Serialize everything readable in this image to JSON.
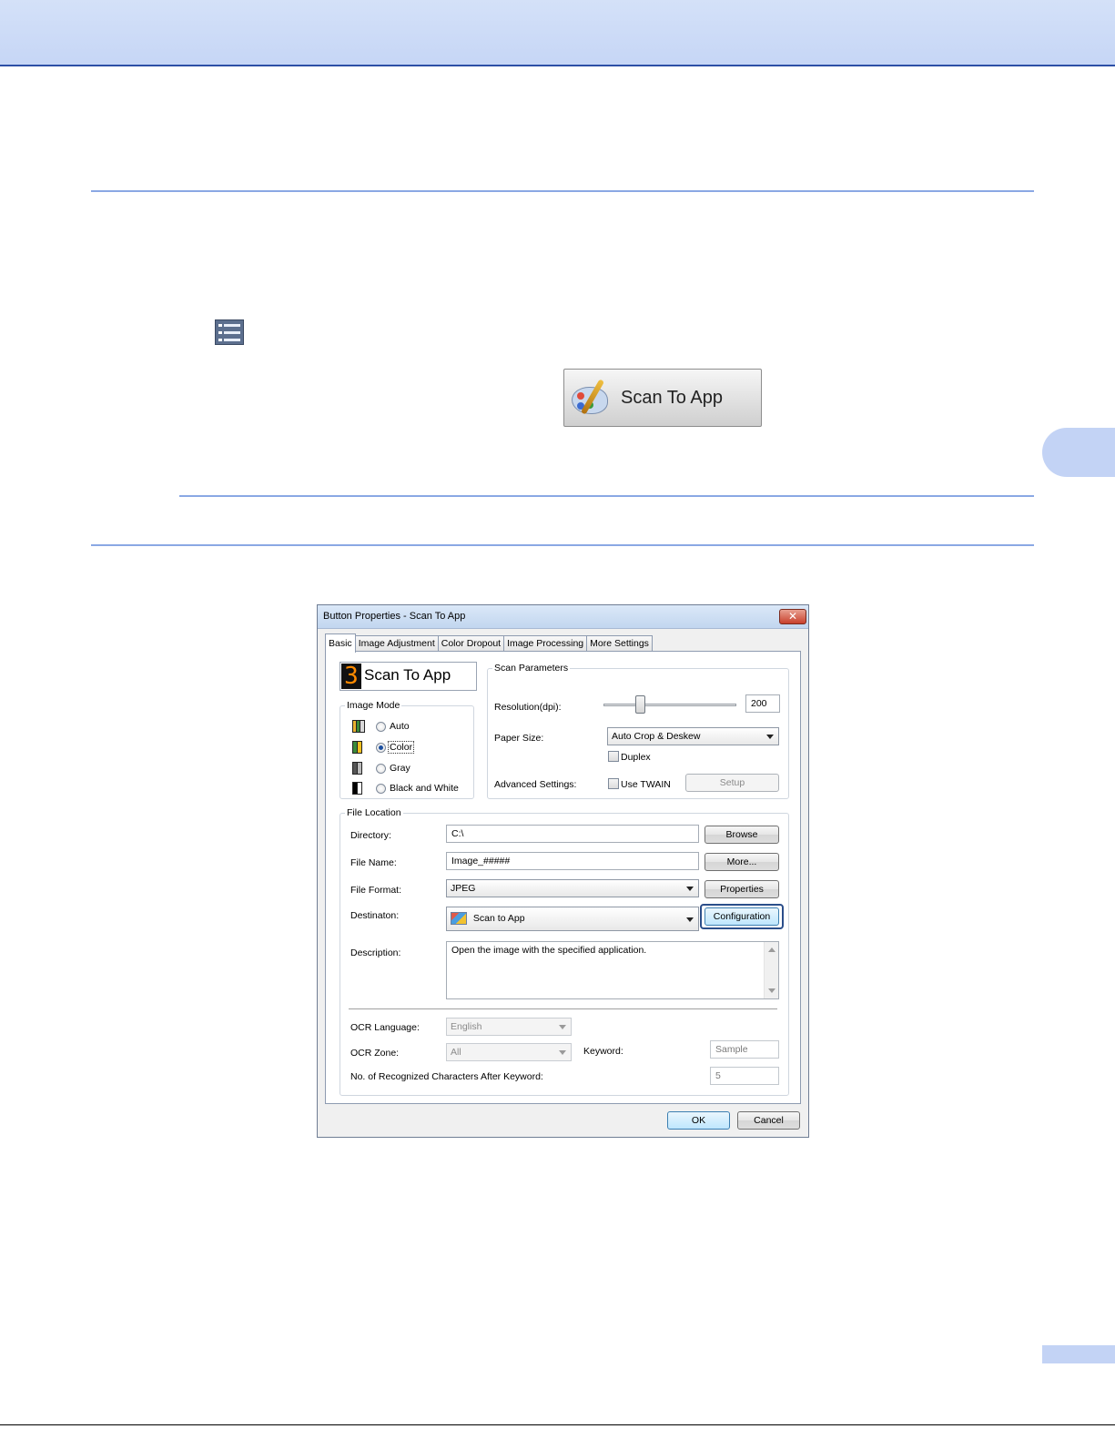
{
  "scan_app_button": {
    "label": "Scan To App"
  },
  "dialog": {
    "title": "Button Properties - Scan To App",
    "close_symbol": "✕",
    "tabs": [
      "Basic",
      "Image Adjustment",
      "Color Dropout",
      "Image Processing",
      "More Settings"
    ],
    "active_tab": "Basic",
    "button_number": "3",
    "button_name": "Scan To App",
    "image_mode": {
      "legend": "Image Mode",
      "options": [
        "Auto",
        "Color",
        "Gray",
        "Black and White"
      ],
      "selected": "Color"
    },
    "scan_parameters": {
      "legend": "Scan Parameters",
      "resolution_label": "Resolution(dpi):",
      "resolution_value": "200",
      "resolution_slider_fraction": 0.26,
      "paper_size_label": "Paper Size:",
      "paper_size_value": "Auto Crop & Deskew",
      "duplex_label": "Duplex",
      "duplex_checked": false,
      "advanced_label": "Advanced Settings:",
      "use_twain_label": "Use TWAIN",
      "use_twain_checked": false,
      "setup_label": "Setup"
    },
    "file_location": {
      "legend": "File Location",
      "directory_label": "Directory:",
      "directory_value": "C:\\",
      "browse_label": "Browse",
      "file_name_label": "File Name:",
      "file_name_value": "Image_#####",
      "more_label": "More...",
      "file_format_label": "File Format:",
      "file_format_value": "JPEG",
      "properties_label": "Properties",
      "destination_label": "Destinaton:",
      "destination_value": "Scan to App",
      "configuration_label": "Configuration",
      "description_label": "Description:",
      "description_value": "Open the image with the specified application.",
      "ocr_language_label": "OCR Language:",
      "ocr_language_value": "English",
      "ocr_zone_label": "OCR Zone:",
      "ocr_zone_value": "All",
      "keyword_label": "Keyword:",
      "keyword_value": "Sample",
      "recognized_label": "No. of Recognized Characters After Keyword:",
      "recognized_value": "5"
    },
    "ok_label": "OK",
    "cancel_label": "Cancel"
  }
}
